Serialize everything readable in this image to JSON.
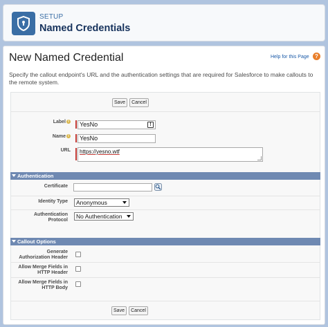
{
  "header": {
    "section": "SETUP",
    "title": "Named Credentials",
    "icon": "shield-icon"
  },
  "page": {
    "title": "New Named Credential",
    "help_link": "Help for this Page",
    "description": "Specify the callout endpoint's URL and the authentication settings that are required for Salesforce to make callouts to the remote system."
  },
  "buttons": {
    "save": "Save",
    "cancel": "Cancel"
  },
  "fields": {
    "label": {
      "label": "Label",
      "value": "YesNo"
    },
    "name": {
      "label": "Name",
      "value": "YesNo"
    },
    "url": {
      "label": "URL",
      "value": "https://yesno.wtf"
    }
  },
  "authentication": {
    "title": "Authentication",
    "certificate_label": "Certificate",
    "certificate_value": "",
    "identity_type_label": "Identity Type",
    "identity_type_value": "Anonymous",
    "protocol_label_line1": "Authentication",
    "protocol_label_line2": "Protocol",
    "protocol_value": "No Authentication"
  },
  "callout_options": {
    "title": "Callout Options",
    "generate_header_line1": "Generate",
    "generate_header_line2": "Authorization Header",
    "generate_header_checked": false,
    "merge_header_line1": "Allow Merge Fields in",
    "merge_header_line2": "HTTP Header",
    "merge_header_checked": false,
    "merge_body_line1": "Allow Merge Fields in",
    "merge_body_line2": "HTTP Body",
    "merge_body_checked": false
  },
  "colors": {
    "accent": "#3a6ea5",
    "section_bar": "#6f89b2",
    "required": "#c23934",
    "background": "#b0c4df"
  }
}
